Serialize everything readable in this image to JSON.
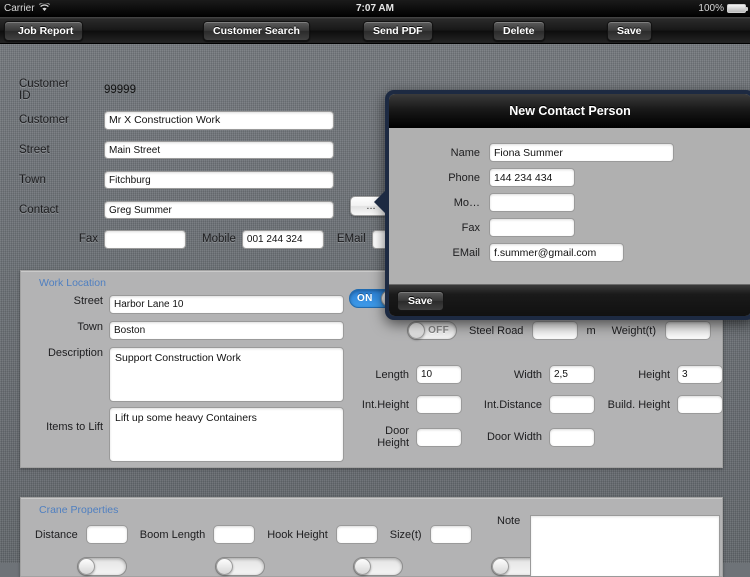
{
  "statusbar": {
    "carrier": "Carrier",
    "wifi_icon": "wifi-icon",
    "time": "7:07 AM",
    "battery_percent": "100%",
    "battery_icon": "battery-icon"
  },
  "toolbar": {
    "back_label": "Job Report",
    "customer_search_label": "Customer Search",
    "send_pdf_label": "Send PDF",
    "delete_label": "Delete",
    "save_label": "Save"
  },
  "customer": {
    "id_label": "Customer ID",
    "id_value": "99999",
    "customer_label": "Customer",
    "customer_value": "Mr X Construction Work",
    "street_label": "Street",
    "street_value": "Main Street",
    "town_label": "Town",
    "town_value": "Fitchburg",
    "contact_label": "Contact",
    "contact_value": "Greg Summer",
    "contact_picker_label": "...",
    "fax_label": "Fax",
    "fax_value": "",
    "mobile_label": "Mobile",
    "mobile_value": "001 244 324",
    "email_label": "EMail",
    "email_value": ""
  },
  "work_location": {
    "title": "Work Location",
    "street_label": "Street",
    "street_value": "Harbor Lane 10",
    "town_label": "Town",
    "town_value": "Boston",
    "description_label": "Description",
    "description_value": "Support Construction Work",
    "items_label": "Items to Lift",
    "items_value": "Lift up some heavy Containers",
    "toggle_on_label": "ON",
    "steel_road_toggle_label": "OFF",
    "steel_road_label": "Steel Road",
    "steel_road_value": "",
    "meter_unit": "m",
    "weight_label": "Weight(t)",
    "weight_value": "",
    "length_label": "Length",
    "length_value": "10",
    "width_label": "Width",
    "width_value": "2,5",
    "height_label": "Height",
    "height_value": "3",
    "int_height_label": "Int.Height",
    "int_height_value": "",
    "int_distance_label": "Int.Distance",
    "int_distance_value": "",
    "build_height_label": "Build. Height",
    "build_height_value": "",
    "door_height_label": "Door Height",
    "door_height_value": "",
    "door_width_label": "Door Width",
    "door_width_value": ""
  },
  "crane": {
    "title": "Crane Properties",
    "distance_label": "Distance",
    "distance_value": "",
    "boom_length_label": "Boom Length",
    "boom_length_value": "",
    "hook_height_label": "Hook Height",
    "hook_height_value": "",
    "size_label": "Size(t)",
    "size_value": "",
    "note_label": "Note",
    "note_value": ""
  },
  "modal": {
    "title": "New Contact Person",
    "name_label": "Name",
    "name_value": "Fiona Summer",
    "phone_label": "Phone",
    "phone_value": "144 234 434",
    "mobile_label": "Mo…",
    "mobile_value": "",
    "fax_label": "Fax",
    "fax_value": "",
    "email_label": "EMail",
    "email_value": "f.summer@gmail.com",
    "save_label": "Save"
  },
  "colors": {
    "background": "#6c7175",
    "panel": "#b3b3b4",
    "panel_title": "#4f7fc0",
    "modal_border": "#1d2a42",
    "toggle_on": "#2b7fd4"
  }
}
